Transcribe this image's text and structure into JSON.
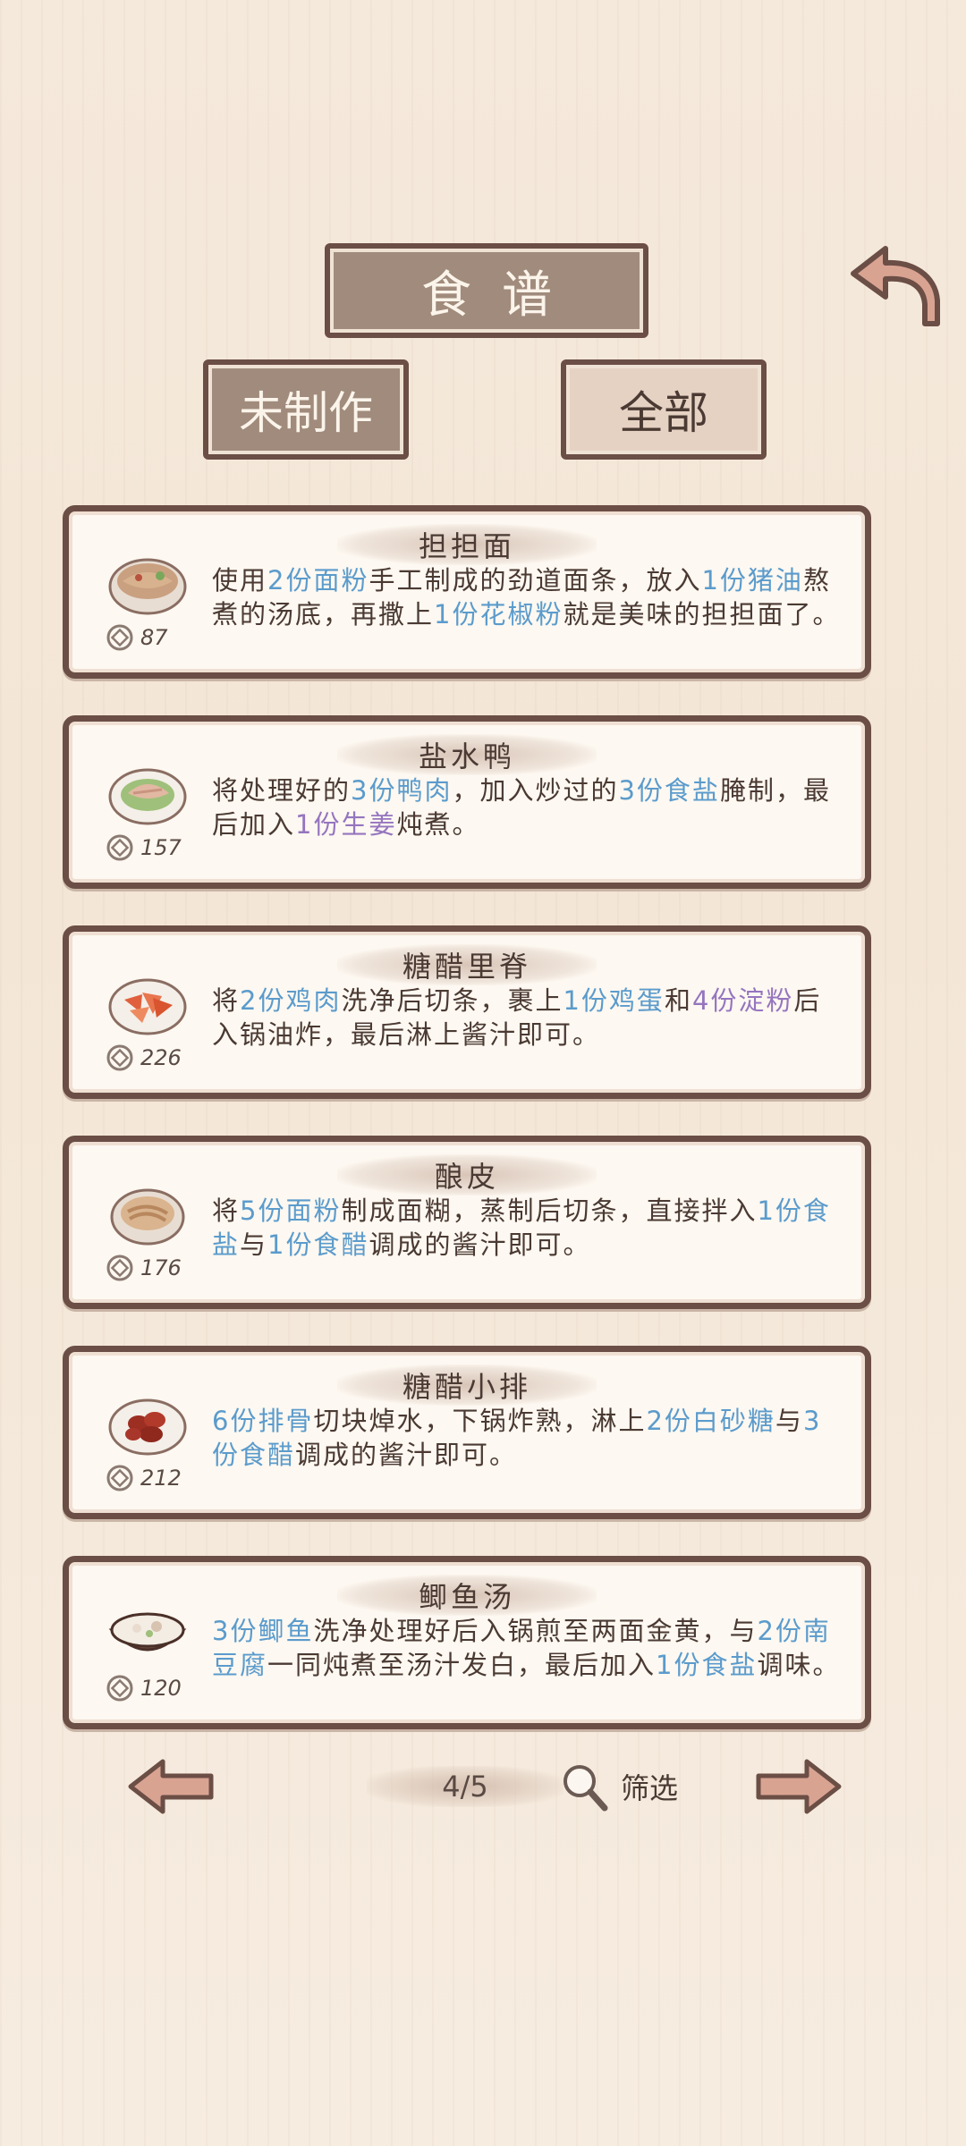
{
  "header": {
    "title": "食谱",
    "back_icon": "back-arrow-icon"
  },
  "tabs": [
    {
      "label": "未制作"
    },
    {
      "label": "全部"
    }
  ],
  "recipes": [
    {
      "name": "担担面",
      "coins": "87",
      "dish_icon": "noodle-bowl-icon",
      "desc_html": "使用<span class=\"hl-blue\">2份面粉</span>手工制成的劲道面条，放入<span class=\"hl-blue\">1份猪油</span>熬煮的汤底，再撒上<span class=\"hl-blue\">1份花椒粉</span>就是美味的担担面了。"
    },
    {
      "name": "盐水鸭",
      "coins": "157",
      "dish_icon": "duck-plate-icon",
      "desc_html": "将处理好的<span class=\"hl-blue\">3份鸭肉</span>，加入炒过的<span class=\"hl-blue\">3份食盐</span>腌制，最后加入<span class=\"hl-purple\">1份生姜</span>炖煮。"
    },
    {
      "name": "糖醋里脊",
      "coins": "226",
      "dish_icon": "fried-pork-icon",
      "desc_html": "将<span class=\"hl-blue\">2份鸡肉</span>洗净后切条，裹上<span class=\"hl-blue\">1份鸡蛋</span>和<span class=\"hl-purple\">4份淀粉</span>后入锅油炸，最后淋上酱汁即可。"
    },
    {
      "name": "酿皮",
      "coins": "176",
      "dish_icon": "liangpi-bowl-icon",
      "desc_html": "将<span class=\"hl-blue\">5份面粉</span>制成面糊，蒸制后切条，直接拌入<span class=\"hl-blue\">1份食盐</span>与<span class=\"hl-blue\">1份食醋</span>调成的酱汁即可。"
    },
    {
      "name": "糖醋小排",
      "coins": "212",
      "dish_icon": "spare-ribs-icon",
      "desc_html": "<span class=\"hl-blue\">6份排骨</span>切块焯水，下锅炸熟，淋上<span class=\"hl-blue\">2份白砂糖</span>与<span class=\"hl-blue\">3份食醋</span>调成的酱汁即可。"
    },
    {
      "name": "鲫鱼汤",
      "coins": "120",
      "dish_icon": "fish-soup-pot-icon",
      "desc_html": "<span class=\"hl-blue\">3份鲫鱼</span>洗净处理好后入锅煎至两面金黄，与<span class=\"hl-blue\">2份南豆腐</span>一同炖煮至汤汁发白，最后加入<span class=\"hl-blue\">1份食盐</span>调味。"
    }
  ],
  "pagination": {
    "page": "4/5",
    "filter_label": "筛选",
    "prev_icon": "left-arrow-icon",
    "next_icon": "right-arrow-icon",
    "filter_icon": "magnifier-icon"
  },
  "colors": {
    "frame": "#6b4e45",
    "plaque": "#a08b7c",
    "card_bg": "#fdf8f1",
    "highlight_blue": "#5b9bcc",
    "highlight_purple": "#9575bf"
  }
}
